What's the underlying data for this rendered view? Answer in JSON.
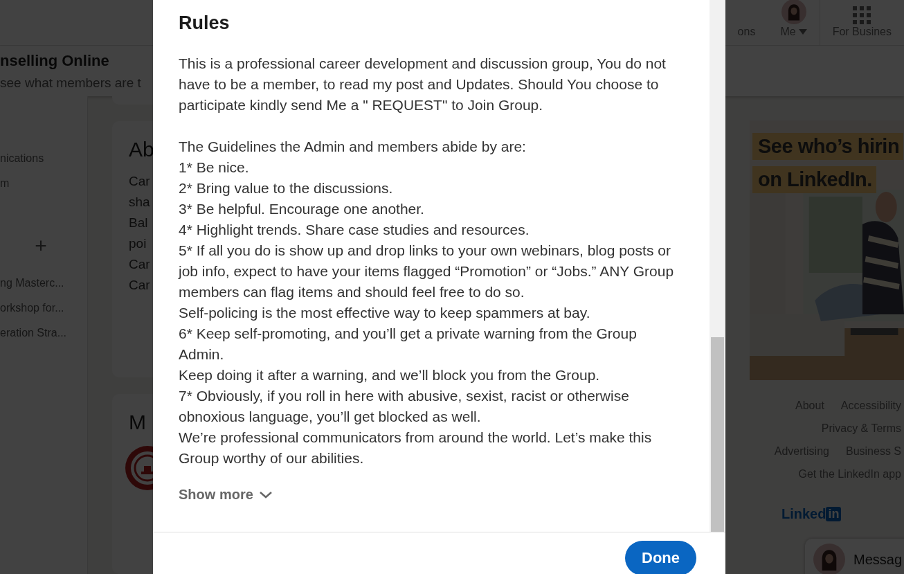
{
  "nav": {
    "items": [
      {
        "label": "ons",
        "kind": "text"
      },
      {
        "label": "Me",
        "kind": "avatar"
      },
      {
        "label": "For Busines",
        "kind": "grid"
      }
    ]
  },
  "group_header": {
    "title": "nselling Online",
    "subtitle": "see what members are t"
  },
  "sidebar": {
    "items": [
      {
        "label": "nications",
        "kind": "text"
      },
      {
        "label": "m",
        "kind": "text"
      },
      {
        "label": "+",
        "kind": "add"
      },
      {
        "label": "ng Masterc...",
        "kind": "text"
      },
      {
        "label": "orkshop for...",
        "kind": "text"
      },
      {
        "label": "eration Stra...",
        "kind": "text"
      }
    ]
  },
  "about_card": {
    "title": "Ab",
    "lines": [
      "Car",
      "sha",
      "Bal",
      "poi",
      "Car",
      "Car"
    ]
  },
  "members_card": {
    "title": "M"
  },
  "ad": {
    "lines": [
      "See who’s hirin",
      "on LinkedIn."
    ]
  },
  "footer": {
    "rows": [
      [
        "About",
        "Accessibility"
      ],
      [
        "Privacy & Terms"
      ],
      [
        "Advertising",
        "Business S"
      ],
      [
        "Get the LinkedIn app"
      ]
    ],
    "brand": "Linked",
    "brand_box": "in"
  },
  "messaging": {
    "label": "Messag"
  },
  "modal": {
    "title": "Rules",
    "intro": "This is a professional career development and discussion group, You do not have to be a member, to read my post and Updates. Should You choose to participate kindly send Me a \" REQUEST\" to Join Group.",
    "guidelines": [
      "The Guidelines the Admin and members abide by are:",
      "1* Be nice.",
      "2* Bring value to the discussions.",
      "3* Be helpful. Encourage one another.",
      "4* Highlight trends. Share case studies and resources.",
      "5* If all you do is show up and drop links to your own webinars, blog posts or job info, expect to have your items flagged “Promotion” or “Jobs.” ANY Group members can flag items and should feel free to do so.",
      "Self-policing is the most effective way to keep spammers at bay.",
      "6* Keep self-promoting, and you’ll get a private warning from the Group Admin.",
      "Keep doing it after a warning, and we’ll block you from the Group.",
      "7* Obviously, if you roll in here with abusive, sexist, racist or otherwise obnoxious language, you’ll get blocked as well.",
      "We’re professional communicators from around the world. Let’s make this Group worthy of our abilities."
    ],
    "show_more": "Show more",
    "done": "Done"
  }
}
